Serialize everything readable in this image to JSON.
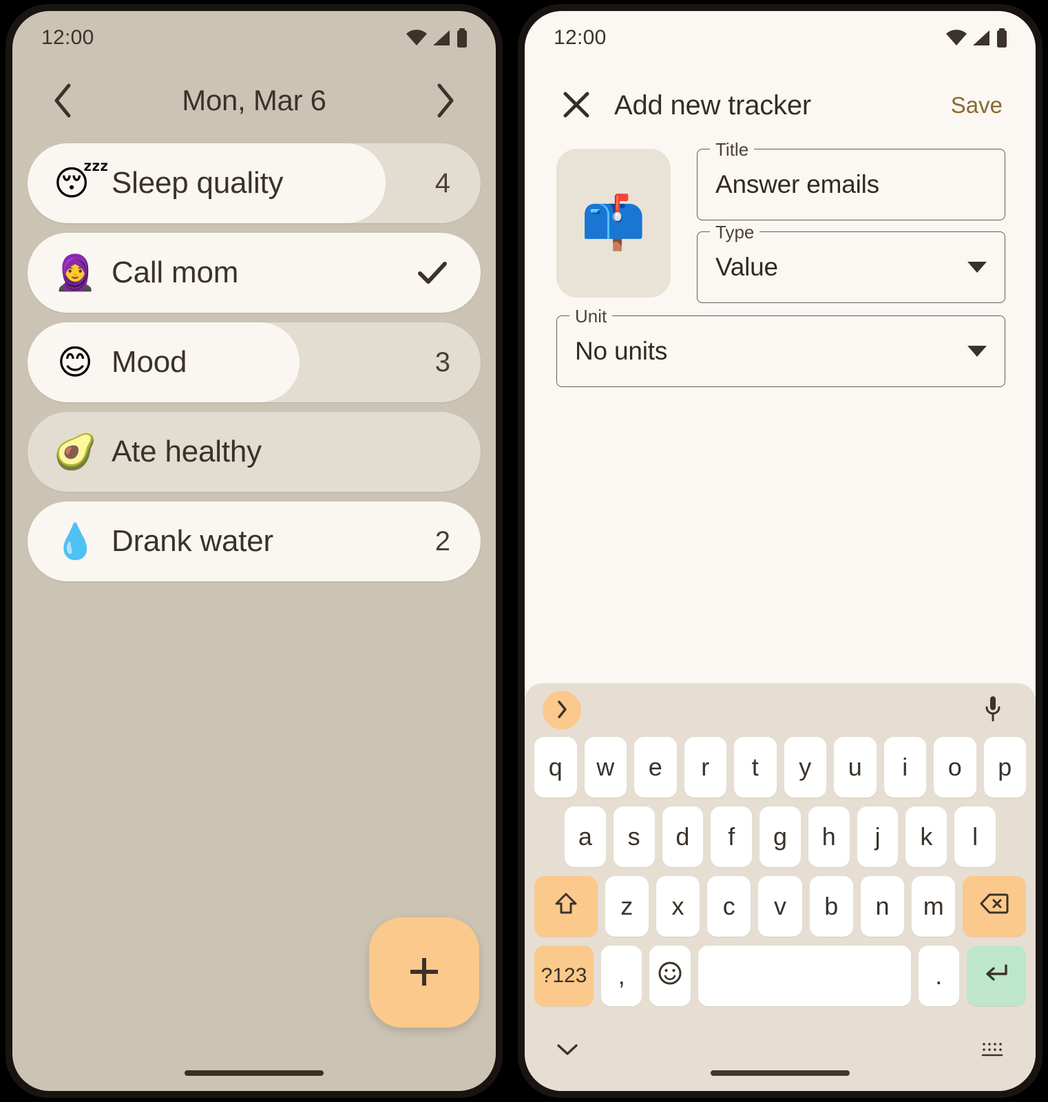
{
  "left_phone": {
    "status_bar": {
      "time": "12:00",
      "icons": [
        "wifi-icon",
        "cell-signal-icon",
        "battery-icon"
      ]
    },
    "date_nav": {
      "prev_label": "chevron-left-icon",
      "date": "Mon, Mar 6",
      "next_label": "chevron-right-icon"
    },
    "trackers": [
      {
        "emoji": "😴",
        "emoji_name": "sleeping-face-emoji",
        "title": "Sleep quality",
        "value": "4",
        "fill_percent": 79,
        "checked": false
      },
      {
        "emoji": "🧕",
        "emoji_name": "woman-with-headscarf-emoji",
        "title": "Call mom",
        "value": "",
        "fill_percent": 100,
        "checked": true
      },
      {
        "emoji": "😊",
        "emoji_name": "smiling-face-emoji",
        "title": "Mood",
        "value": "3",
        "fill_percent": 60,
        "checked": false
      },
      {
        "emoji": "🥑",
        "emoji_name": "avocado-emoji",
        "title": "Ate healthy",
        "value": "",
        "fill_percent": 0,
        "checked": false
      },
      {
        "emoji": "💧",
        "emoji_name": "droplet-emoji",
        "title": "Drank water",
        "value": "2",
        "fill_percent": 100,
        "checked": false
      }
    ],
    "fab": {
      "icon": "plus-icon",
      "color": "#FBC98B"
    }
  },
  "right_phone": {
    "status_bar": {
      "time": "12:00",
      "icons": [
        "wifi-icon",
        "cell-signal-icon",
        "battery-icon"
      ]
    },
    "app_bar": {
      "close_icon": "close-icon",
      "title": "Add new tracker",
      "save_label": "Save",
      "save_color": "#8B6A2E"
    },
    "form": {
      "emoji_picker": {
        "emoji": "📫",
        "emoji_name": "mailbox-emoji"
      },
      "title_field": {
        "label": "Title",
        "value": "Answer emails"
      },
      "type_field": {
        "label": "Type",
        "value": "Value"
      },
      "unit_field": {
        "label": "Unit",
        "value": "No units"
      }
    },
    "keyboard": {
      "toolbar": {
        "expand_icon": "chevron-right-icon",
        "mic_icon": "microphone-icon"
      },
      "row1": [
        "q",
        "w",
        "e",
        "r",
        "t",
        "y",
        "u",
        "i",
        "o",
        "p"
      ],
      "row2": [
        "a",
        "s",
        "d",
        "f",
        "g",
        "h",
        "j",
        "k",
        "l"
      ],
      "row3_shift": "shift-icon",
      "row3": [
        "z",
        "x",
        "c",
        "v",
        "b",
        "n",
        "m"
      ],
      "row3_backspace": "backspace-icon",
      "row4": {
        "symbols": "?123",
        "comma": ",",
        "emoji": "emoji-icon",
        "space": "",
        "period": ".",
        "enter": "enter-icon"
      },
      "footer": {
        "hide_icon": "chevron-down-icon",
        "switch_icon": "keyboard-switch-icon"
      }
    }
  },
  "theme": {
    "home_background": "#CBC4B4",
    "form_background": "#FBF7F3",
    "track_color": "#E3DCD1",
    "fill_color": "#FAF6F1",
    "accent": "#FBC98B",
    "enter_key": "#BEE6CB",
    "text": "#3B322A"
  }
}
